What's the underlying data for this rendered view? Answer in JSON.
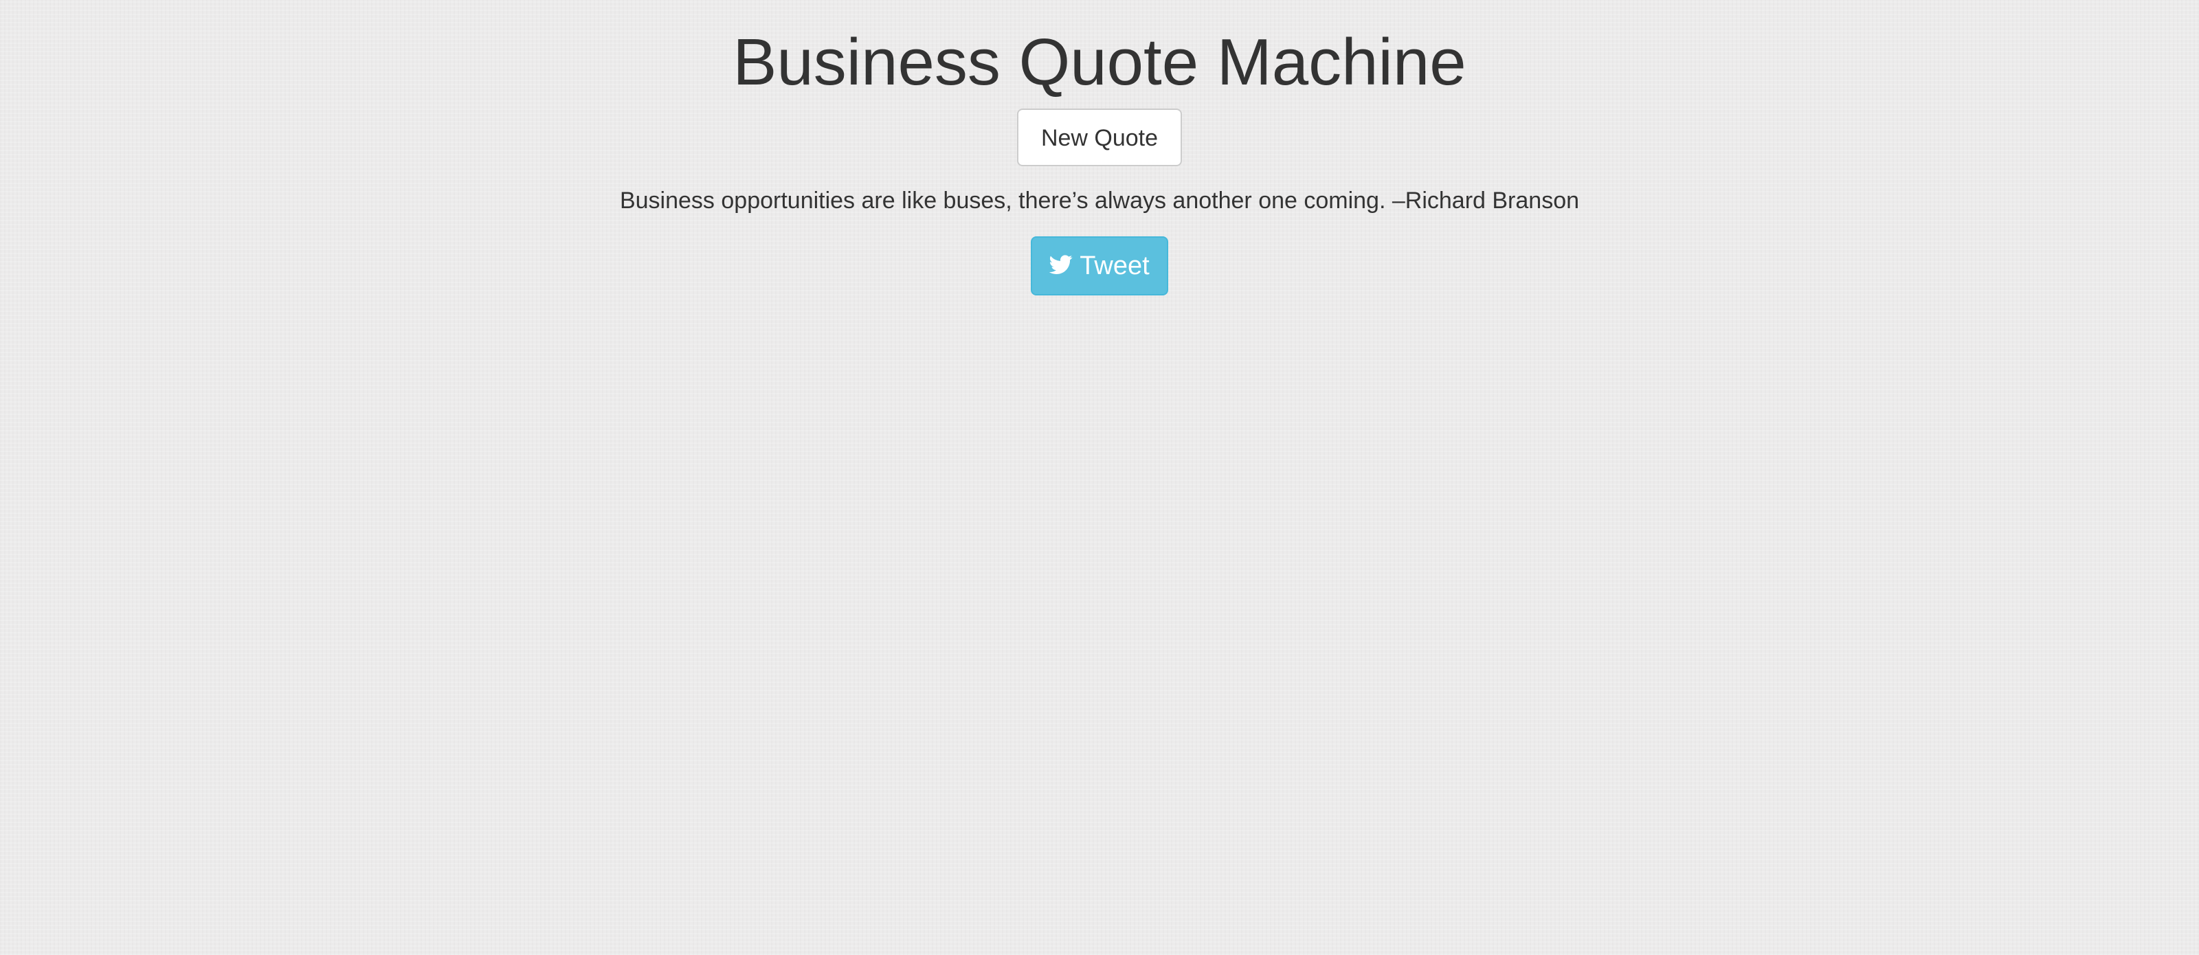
{
  "page": {
    "title": "Business Quote Machine",
    "background_color": "#ecebeb"
  },
  "buttons": {
    "new_quote_label": "New Quote",
    "tweet_label": "Tweet",
    "tweet_color": "#5bc0de",
    "tweet_icon": "twitter-icon"
  },
  "quote": {
    "text": "Business opportunities are like buses, there’s always another one coming. –Richard Branson"
  }
}
